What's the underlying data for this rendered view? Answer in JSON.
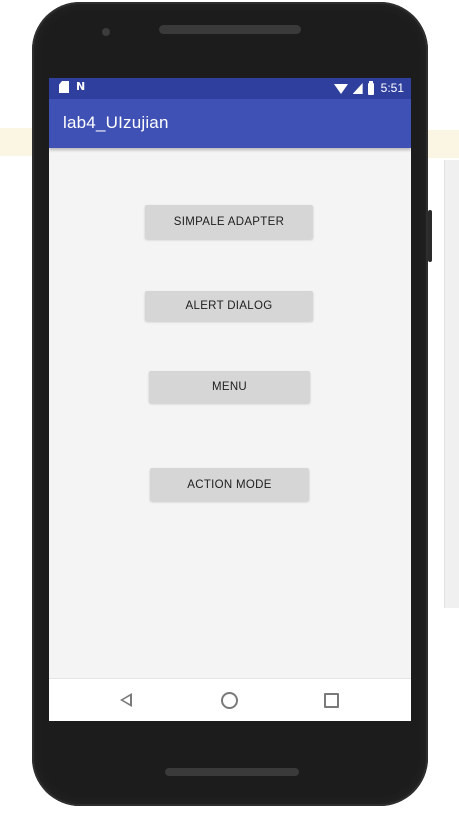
{
  "status_bar": {
    "left_icons": [
      "sim-card-icon",
      "n-notification-icon"
    ],
    "right_icons": [
      "wifi-icon",
      "signal-icon",
      "battery-icon"
    ],
    "time": "5:51",
    "n_glyph": "N"
  },
  "app_bar": {
    "title": "lab4_UIzujian"
  },
  "buttons": [
    {
      "label": "SIMPALE ADAPTER"
    },
    {
      "label": "ALERT DIALOG"
    },
    {
      "label": "MENU"
    },
    {
      "label": "ACTION MODE"
    }
  ],
  "nav_bar": {
    "icons": [
      "back-icon",
      "home-icon",
      "recents-icon"
    ]
  },
  "colors": {
    "status_bar": "#2f3f9e",
    "app_bar": "#3f51b5",
    "screen_bg": "#f4f4f4",
    "button_bg": "#d6d6d6",
    "device_frame": "#1c1c1c"
  }
}
